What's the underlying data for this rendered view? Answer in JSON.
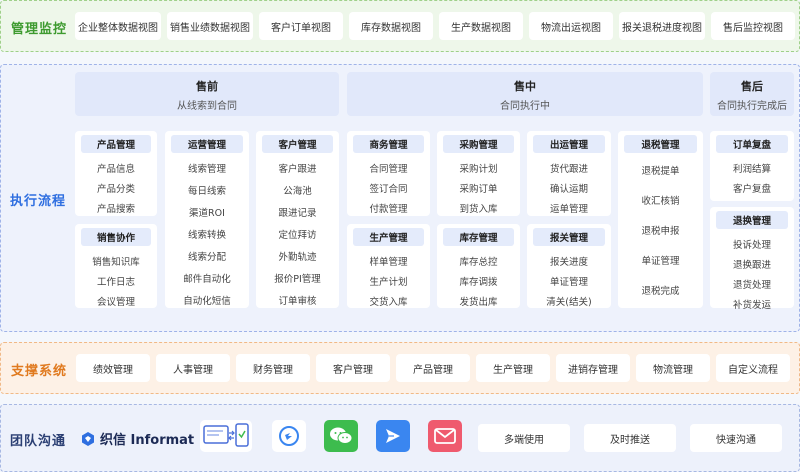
{
  "monitor": {
    "title": "管理监控",
    "views": [
      "企业整体数据视图",
      "销售业绩数据视图",
      "客户订单视图",
      "库存数据视图",
      "生产数据视图",
      "物流出运视图",
      "报关退税进度视图",
      "售后监控视图"
    ]
  },
  "execution": {
    "title": "执行流程",
    "phases": [
      {
        "title": "售前",
        "sub": "从线索到合同"
      },
      {
        "title": "售中",
        "sub": "合同执行中"
      },
      {
        "title": "售后",
        "sub": "合同执行完成后"
      }
    ],
    "cards": {
      "product": {
        "title": "产品管理",
        "items": [
          "产品信息",
          "产品分类",
          "产品搜索"
        ]
      },
      "sales_collab": {
        "title": "销售协作",
        "items": [
          "销售知识库",
          "工作日志",
          "会议管理"
        ]
      },
      "ops": {
        "title": "运营管理",
        "items": [
          "线索管理",
          "每日线索",
          "渠道ROI",
          "线索转换",
          "线索分配",
          "邮件自动化",
          "自动化短信"
        ]
      },
      "customer": {
        "title": "客户管理",
        "items": [
          "客户跟进",
          "公海池",
          "跟进记录",
          "定位拜访",
          "外勤轨迹",
          "报价PI管理",
          "订单审核"
        ]
      },
      "business": {
        "title": "商务管理",
        "items": [
          "合同管理",
          "签订合同",
          "付款管理"
        ]
      },
      "production": {
        "title": "生产管理",
        "items": [
          "样单管理",
          "生产计划",
          "交货入库"
        ]
      },
      "purchase": {
        "title": "采购管理",
        "items": [
          "采购计划",
          "采购订单",
          "到货入库"
        ]
      },
      "inventory": {
        "title": "库存管理",
        "items": [
          "库存总控",
          "库存调拨",
          "发货出库"
        ]
      },
      "shipping": {
        "title": "出运管理",
        "items": [
          "货代跟进",
          "确认运期",
          "运单管理"
        ]
      },
      "customs": {
        "title": "报关管理",
        "items": [
          "报关进度",
          "单证管理",
          "清关(结关)"
        ]
      },
      "tax": {
        "title": "退税管理",
        "items": [
          "退税提单",
          "收汇核销",
          "退税申报",
          "单证管理",
          "退税完成"
        ]
      },
      "order_review": {
        "title": "订单复盘",
        "items": [
          "利润结算",
          "客户复盘"
        ]
      },
      "returns": {
        "title": "退换管理",
        "items": [
          "投诉处理",
          "退换跟进",
          "退货处理",
          "补货发运"
        ]
      }
    }
  },
  "support": {
    "title": "支撑系统",
    "items": [
      "绩效管理",
      "人事管理",
      "财务管理",
      "客户管理",
      "产品管理",
      "生产管理",
      "进销存管理",
      "物流管理",
      "自定义流程"
    ]
  },
  "team": {
    "title": "团队沟通",
    "logo_text": "织信 Informat",
    "icons": [
      "sync-devices-icon",
      "dingtalk-icon",
      "wechat-icon",
      "feishu-icon",
      "mail-icon"
    ],
    "features": [
      "多端使用",
      "及时推送",
      "快速沟通"
    ]
  },
  "colors": {
    "monitor_title": "#3d9a2f",
    "execution_title": "#2f6fe0",
    "support_title": "#e07a1f",
    "team_title": "#2b3f73",
    "wechat": "#3dbc4e",
    "feishu": "#3a86f0",
    "mail": "#ef5a6e"
  }
}
